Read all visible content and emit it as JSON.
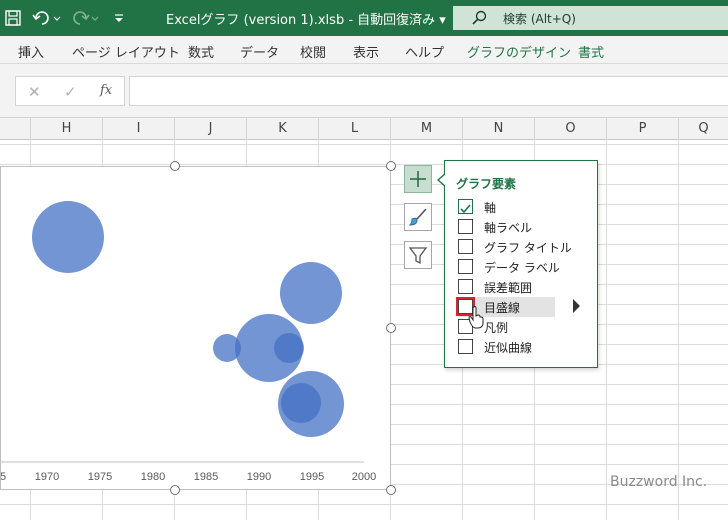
{
  "window": {
    "title": "Excelグラフ (version 1).xlsb  -  自動回復済み  ▾",
    "search_placeholder": "検索 (Alt+Q)"
  },
  "ribbon": {
    "tabs": [
      {
        "label": "挿入"
      },
      {
        "label": "ページ レイアウト"
      },
      {
        "label": "数式"
      },
      {
        "label": "データ"
      },
      {
        "label": "校閲"
      },
      {
        "label": "表示"
      },
      {
        "label": "ヘルプ"
      },
      {
        "label": "グラフのデザイン"
      },
      {
        "label": "書式"
      }
    ]
  },
  "formula_bar": {
    "cancel": "✕",
    "confirm": "✓",
    "fx": "fx",
    "value": ""
  },
  "columns": [
    "H",
    "I",
    "J",
    "K",
    "L",
    "M",
    "N",
    "O",
    "P",
    "Q"
  ],
  "chart_data": {
    "type": "scatter",
    "x_ticks": [
      "5",
      "1970",
      "1975",
      "1980",
      "1985",
      "1990",
      "1995",
      "2000"
    ]
  },
  "chart_elements": {
    "title": "グラフ要素",
    "items": [
      {
        "label": "軸",
        "checked": true
      },
      {
        "label": "軸ラベル",
        "checked": false
      },
      {
        "label": "グラフ タイトル",
        "checked": false
      },
      {
        "label": "データ ラベル",
        "checked": false
      },
      {
        "label": "誤差範囲",
        "checked": false
      },
      {
        "label": "目盛線",
        "checked": false,
        "highlighted": true
      },
      {
        "label": "凡例",
        "checked": false
      },
      {
        "label": "近似曲線",
        "checked": false
      }
    ]
  },
  "watermark": "Buzzword Inc.",
  "colors": {
    "accent": "#217346",
    "bubble": "#4472c4"
  }
}
